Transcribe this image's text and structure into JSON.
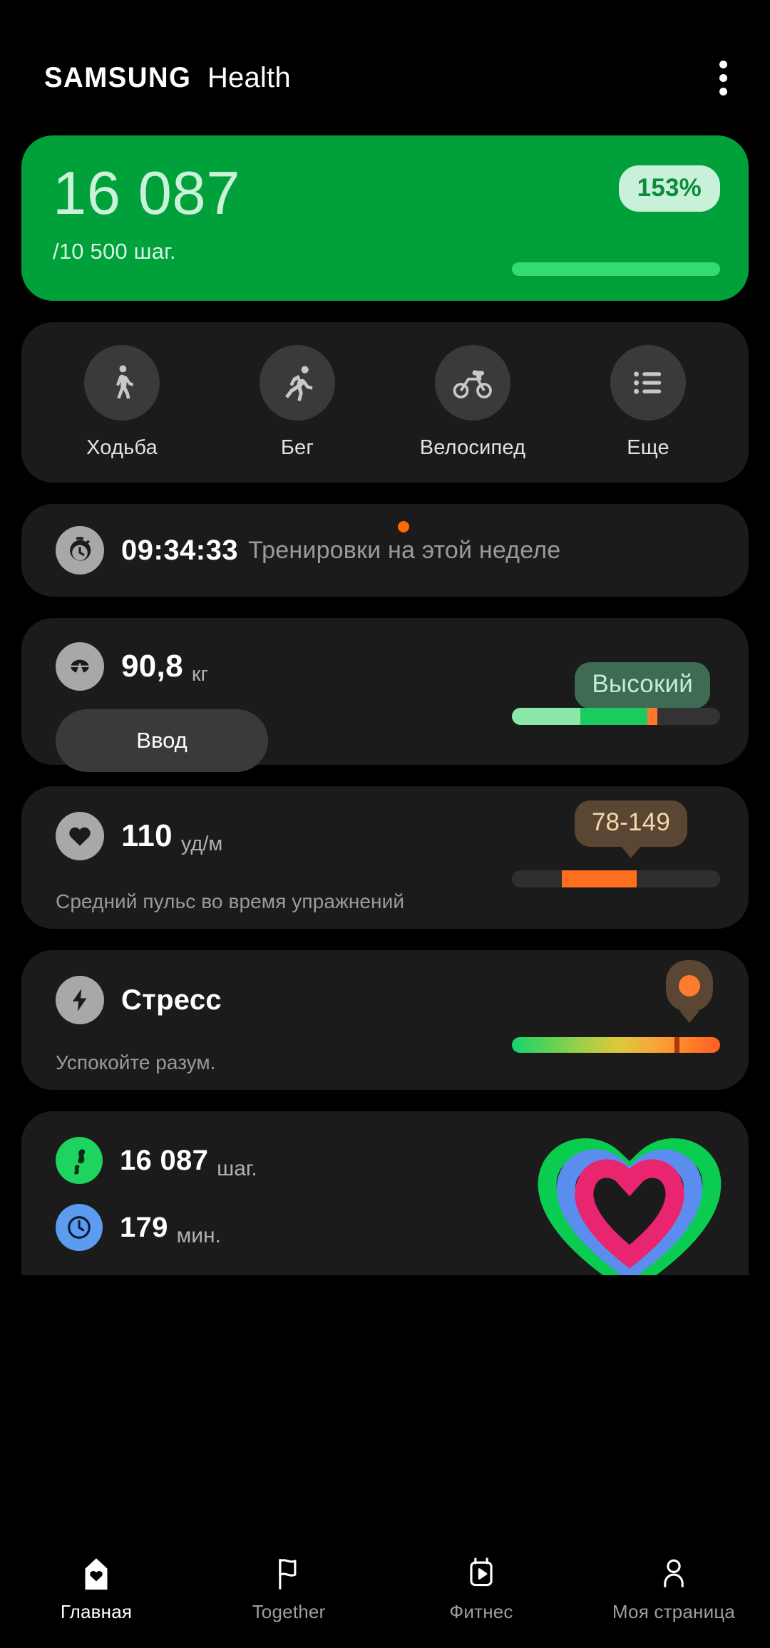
{
  "header": {
    "brand_first": "SAMSUNG",
    "brand_second": "Health",
    "menu_icon": "kebab-menu-icon"
  },
  "steps_card": {
    "count": "16 087",
    "goal": "/10 500 шаг.",
    "percent": "153%",
    "bg_color": "#00A03B",
    "badge_bg": "#C9F0D9",
    "badge_text_color": "#0B8C3A",
    "progress_color": "#33DB70"
  },
  "activities": [
    {
      "label": "Ходьба",
      "icon": "walking-icon"
    },
    {
      "label": "Бег",
      "icon": "running-icon"
    },
    {
      "label": "Велосипед",
      "icon": "cycling-icon"
    },
    {
      "label": "Еще",
      "icon": "list-icon"
    }
  ],
  "timer_card": {
    "icon": "stopwatch-icon",
    "value": "09:34:33",
    "caption": "Тренировки на этой неделе",
    "badge_color": "#FF6A00"
  },
  "weight_card": {
    "icon": "scale-icon",
    "value": "90,8",
    "unit": "кг",
    "button_label": "Ввод",
    "tooltip": "Высокий",
    "tooltip_bg": "#3E6B53",
    "tooltip_text_color": "#BEF0CE",
    "segments": [
      {
        "color": "#8BE8A8",
        "width_pct": 33
      },
      {
        "color": "#1BCB5F",
        "width_pct": 32
      },
      {
        "color": "#FF7733",
        "width_pct": 5
      },
      {
        "color": "#333333",
        "width_pct": 30
      }
    ]
  },
  "heart_rate_card": {
    "icon": "heart-icon",
    "value": "110",
    "unit": "уд/м",
    "caption": "Средний пульс во время упражнений",
    "tooltip": "78-149",
    "tooltip_bg": "#5A4632",
    "tooltip_text_color": "#F4D9AC",
    "bar_track_color": "#2F2F2F",
    "bar_fill_color": "#FF6D1F",
    "bar_fill_start_pct": 24,
    "bar_fill_width_pct": 36
  },
  "stress_card": {
    "icon": "lightning-icon",
    "title": "Стресс",
    "caption": "Успокойте разум.",
    "marker_pct": 78,
    "marker_color": "#A83A0B",
    "pin_color": "#FF7B2E",
    "tooltip_bg": "#5A4632"
  },
  "summary_card": {
    "rows": [
      {
        "icon": "steps-icon",
        "icon_bg": "#1DD45F",
        "value": "16 087",
        "unit": "шаг."
      },
      {
        "icon": "clock-icon",
        "icon_bg": "#5B9BF0",
        "value": "179",
        "unit": "мин."
      }
    ],
    "rings": [
      {
        "name": "steps-ring",
        "color": "#0ACC50"
      },
      {
        "name": "minutes-ring",
        "color": "#5B8DEF"
      },
      {
        "name": "activity-ring",
        "color": "#E8256E"
      }
    ]
  },
  "bottom_nav": [
    {
      "label": "Главная",
      "icon": "home-heart-icon",
      "active": true
    },
    {
      "label": "Together",
      "icon": "flag-icon",
      "active": false
    },
    {
      "label": "Фитнес",
      "icon": "fitness-video-icon",
      "active": false
    },
    {
      "label": "Моя страница",
      "icon": "person-icon",
      "active": false
    }
  ]
}
